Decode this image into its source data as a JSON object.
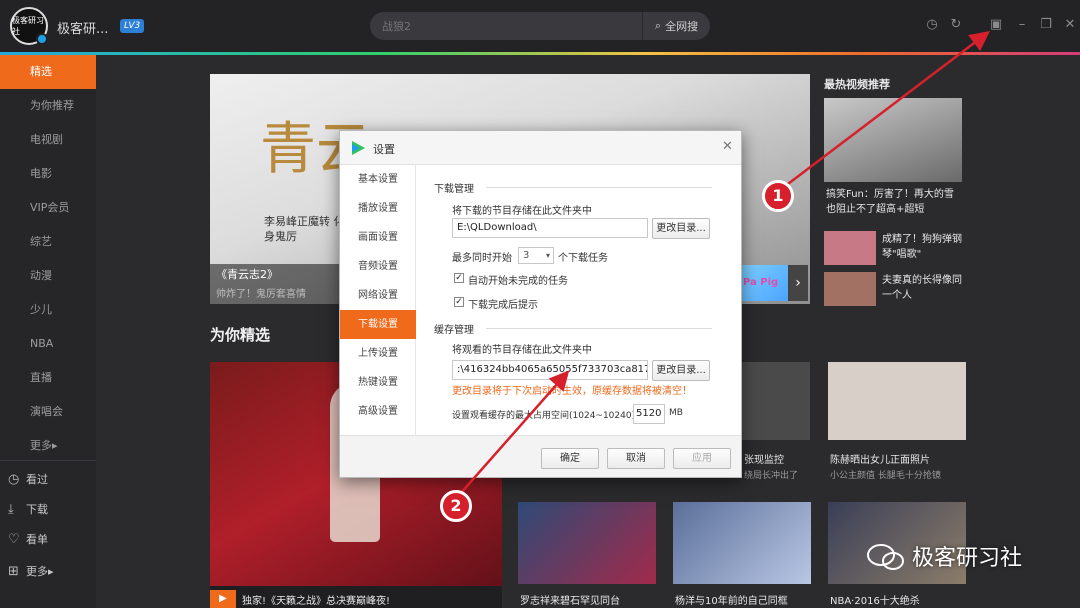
{
  "titlebar": {
    "logo_text": "极客研习社",
    "username": "极客研...",
    "level_badge": "LV3",
    "search_placeholder": "战狼2",
    "search_button": "全网搜"
  },
  "sidebar": {
    "items": [
      {
        "label": "精选",
        "active": true
      },
      {
        "label": "为你推荐"
      },
      {
        "label": "电视剧"
      },
      {
        "label": "电影"
      },
      {
        "label": "VIP会员"
      },
      {
        "label": "综艺"
      },
      {
        "label": "动漫"
      },
      {
        "label": "少儿"
      },
      {
        "label": "NBA"
      },
      {
        "label": "直播"
      },
      {
        "label": "演唱会"
      },
      {
        "label": "更多▸"
      }
    ],
    "utilities": [
      {
        "label": "看过",
        "icon": "clock-icon"
      },
      {
        "label": "下载",
        "icon": "download-icon"
      },
      {
        "label": "看单",
        "icon": "heart-icon"
      },
      {
        "label": "更多▸",
        "icon": "plus-icon"
      }
    ]
  },
  "banner": {
    "title": "《青云志2》",
    "description": "帅炸了！鬼厉套喜情",
    "art_text": "青云",
    "sub_text": "李易峰正魔转 化身鬼厉"
  },
  "section_title": "为你精选",
  "big_card_label": "独家!《天籁之战》总决赛巅峰夜!",
  "cards": [
    {
      "label": "张现监控",
      "sub": "绕局长冲出了"
    },
    {
      "label": "陈赫晒出女儿正面照片",
      "sub": "小公主颜值 长腿毛十分抢镜"
    },
    {
      "label": "罗志祥来碧石罕见同台",
      "sub": ""
    },
    {
      "label": "杨洋与10年前的自己同框",
      "sub": ""
    },
    {
      "label": "NBA·2016十大绝杀",
      "sub": ""
    }
  ],
  "hot": {
    "title": "最热视频推荐",
    "items": [
      {
        "label": "搞笑Fun：厉害了！再大的雪也阻止不了超高+超短"
      },
      {
        "label": "成精了！狗狗弹钢琴\"唱歌\""
      },
      {
        "label": "夫妻真的长得像同一个人"
      }
    ]
  },
  "dialog": {
    "title": "设置",
    "nav": [
      {
        "label": "基本设置"
      },
      {
        "label": "播放设置"
      },
      {
        "label": "画面设置"
      },
      {
        "label": "音频设置"
      },
      {
        "label": "网络设置"
      },
      {
        "label": "下载设置",
        "active": true
      },
      {
        "label": "上传设置"
      },
      {
        "label": "热键设置"
      },
      {
        "label": "高级设置"
      }
    ],
    "download": {
      "section": "下载管理",
      "save_label": "将下载的节目存储在此文件夹中",
      "path": "E:\\QLDownload\\",
      "change_dir": "更改目录...",
      "concurrent_prefix": "最多同时开始",
      "concurrent_value": "3",
      "concurrent_suffix": "个下载任务",
      "auto_resume": "自动开始未完成的任务",
      "notify_done": "下载完成后提示"
    },
    "cache": {
      "section": "缓存管理",
      "save_label": "将观看的节目存储在此文件夹中",
      "path": ":\\416324bb4065a65055f733703ca817e1\\",
      "change_dir": "更改目录...",
      "warning": "更改目录将于下次启动时生效，原缓存数据将被清空！",
      "max_label": "设置观看缓存的最大占用空间(1024~10240)",
      "max_value": "5120",
      "max_unit": "MB"
    },
    "footer": {
      "ok": "确定",
      "cancel": "取消",
      "apply": "应用"
    }
  },
  "annotations": {
    "badge1": "1",
    "badge2": "2"
  },
  "watermark": "极客研习社",
  "colors": {
    "accent": "#f06a1b",
    "annotation": "#d6202b"
  }
}
